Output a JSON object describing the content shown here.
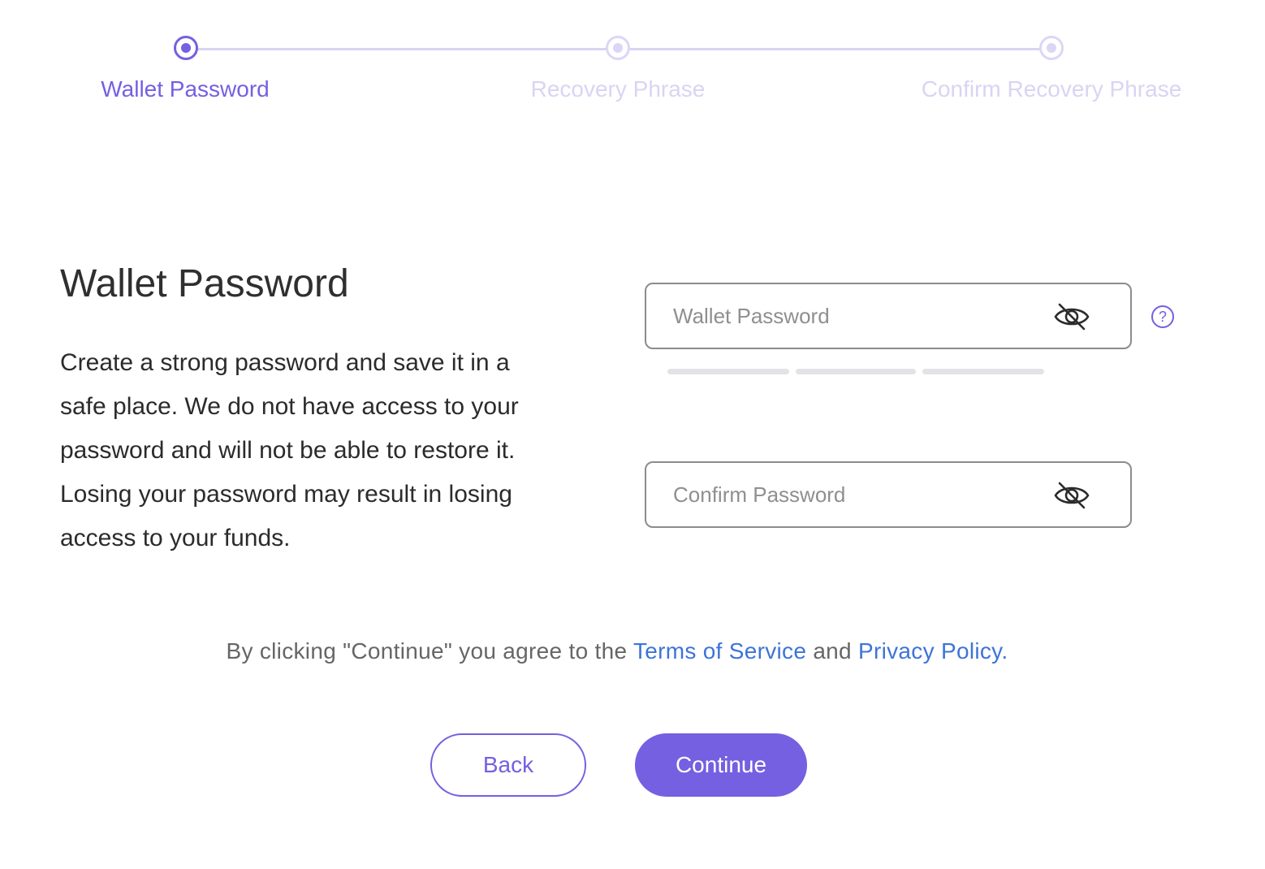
{
  "stepper": {
    "steps": [
      {
        "label": "Wallet Password",
        "state": "active"
      },
      {
        "label": "Recovery Phrase",
        "state": "inactive"
      },
      {
        "label": "Confirm Recovery Phrase",
        "state": "inactive"
      }
    ]
  },
  "main": {
    "title": "Wallet Password",
    "description": "Create a strong password and save it in a safe place. We do not have access to your password and will not be able to restore it. Losing your password may result in losing access to your funds."
  },
  "form": {
    "password": {
      "placeholder": "Wallet Password",
      "value": "",
      "visibility_icon": "eye-off-icon"
    },
    "confirm": {
      "placeholder": "Confirm Password",
      "value": "",
      "visibility_icon": "eye-off-icon"
    },
    "help_icon": "question-circle-icon",
    "help_symbol": "?",
    "strength_segments": 3
  },
  "terms": {
    "prefix": "By clicking \"Continue\" you agree to the ",
    "tos": "Terms of Service",
    "and": " and ",
    "privacy": "Privacy Policy."
  },
  "buttons": {
    "back": "Back",
    "continue": "Continue"
  },
  "colors": {
    "accent": "#7460e0",
    "accent_light": "#d9d4f3",
    "link": "#3d74d8"
  }
}
